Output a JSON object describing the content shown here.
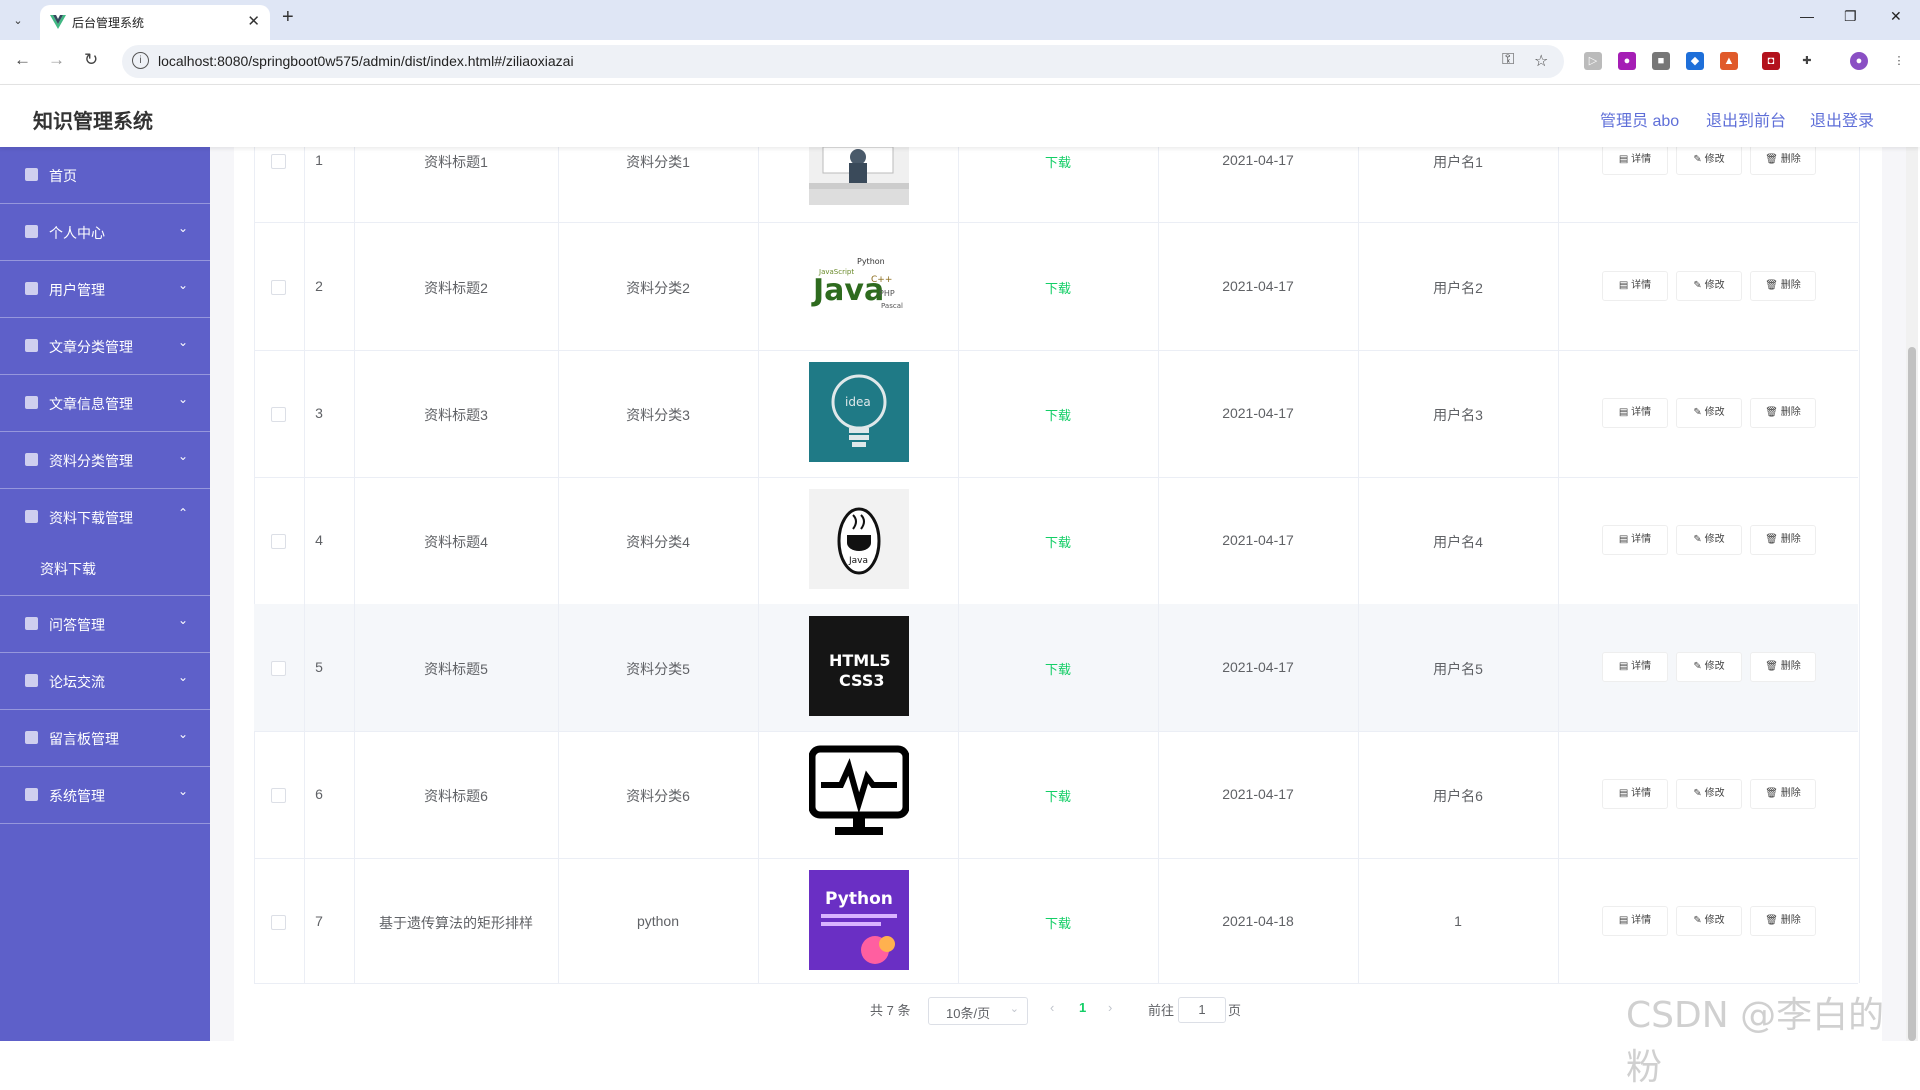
{
  "browser": {
    "tab_title": "后台管理系统",
    "url": "localhost:8080/springboot0w575/admin/dist/index.html#/ziliaoxiazai"
  },
  "header": {
    "app_title": "知识管理系统",
    "admin_label": "管理员 abo",
    "back_to_front": "退出到前台",
    "logout": "退出登录"
  },
  "sidebar": {
    "items": [
      {
        "label": "首页",
        "icon": "home-icon"
      },
      {
        "label": "个人中心",
        "icon": "user-icon"
      },
      {
        "label": "用户管理",
        "icon": "users-icon"
      },
      {
        "label": "文章分类管理",
        "icon": "send-icon"
      },
      {
        "label": "文章信息管理",
        "icon": "document-icon"
      },
      {
        "label": "资料分类管理",
        "icon": "folder-icon"
      },
      {
        "label": "资料下载管理",
        "icon": "grid-icon"
      },
      {
        "label": "问答管理",
        "icon": "qa-icon"
      },
      {
        "label": "论坛交流",
        "icon": "list-icon"
      },
      {
        "label": "留言板管理",
        "icon": "chart-icon"
      },
      {
        "label": "系统管理",
        "icon": "settings-icon"
      }
    ],
    "submenu_label": "资料下载"
  },
  "table": {
    "download_label": "下载",
    "detail_label": "详情",
    "edit_label": "修改",
    "delete_label": "删除",
    "rows": [
      {
        "index": "1",
        "title": "资料标题1",
        "category": "资料分类1",
        "date": "2021-04-17",
        "user": "用户名1"
      },
      {
        "index": "2",
        "title": "资料标题2",
        "category": "资料分类2",
        "date": "2021-04-17",
        "user": "用户名2"
      },
      {
        "index": "3",
        "title": "资料标题3",
        "category": "资料分类3",
        "date": "2021-04-17",
        "user": "用户名3"
      },
      {
        "index": "4",
        "title": "资料标题4",
        "category": "资料分类4",
        "date": "2021-04-17",
        "user": "用户名4"
      },
      {
        "index": "5",
        "title": "资料标题5",
        "category": "资料分类5",
        "date": "2021-04-17",
        "user": "用户名5"
      },
      {
        "index": "6",
        "title": "资料标题6",
        "category": "资料分类6",
        "date": "2021-04-17",
        "user": "用户名6"
      },
      {
        "index": "7",
        "title": "基于遗传算法的矩形排样",
        "category": "python",
        "date": "2021-04-18",
        "user": "1"
      }
    ],
    "thumb_texts": {
      "t2": "Java",
      "t3": "idea",
      "t4": "Java",
      "t5a": "HTML5",
      "t5b": "CSS3",
      "t7": "Python"
    }
  },
  "pagination": {
    "total": "共 7 条",
    "page_size": "10条/页",
    "current_page": "1",
    "goto_prefix": "前往",
    "goto_value": "1",
    "goto_suffix": "页"
  },
  "watermark": "CSDN @李白的粉",
  "colors": {
    "sidebar_bg": "#5e60c9",
    "accent": "#5f6fd8",
    "download_link": "#13ce66"
  }
}
